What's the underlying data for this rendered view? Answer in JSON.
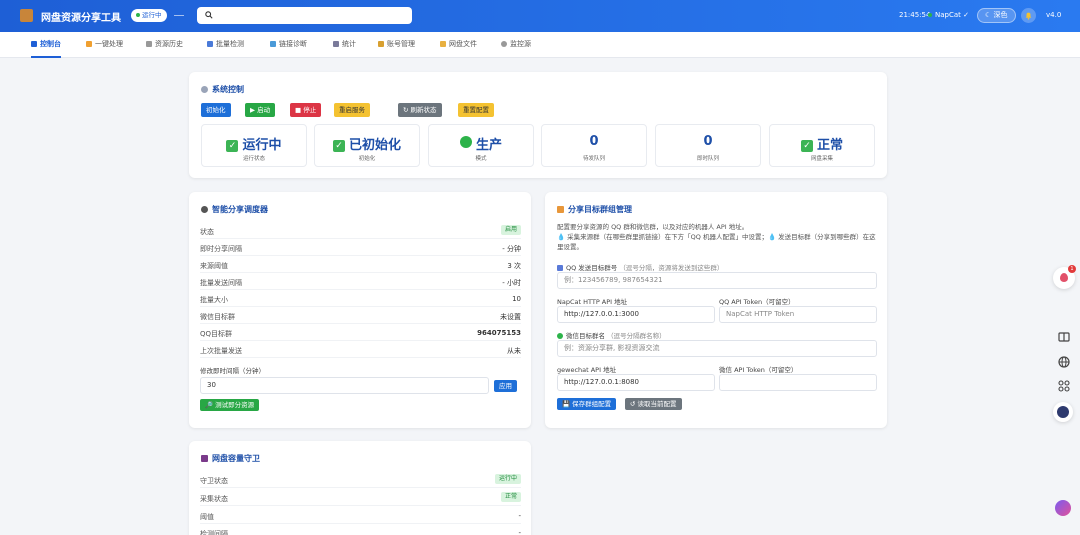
{
  "header": {
    "title": "网盘资源分享工具",
    "status_badge": "运行中",
    "search_placeholder": "",
    "time": "21:45:54",
    "napcat": "NapCat ✓",
    "theme_label": "深色",
    "version": "v4.0"
  },
  "tabs": [
    {
      "label": "控制台",
      "icon": "dashboard-icon",
      "color": "#1e5fd6"
    },
    {
      "label": "一键处理",
      "icon": "bolt-icon",
      "color": "#f0a030"
    },
    {
      "label": "资源历史",
      "icon": "history-icon",
      "color": "#888888"
    },
    {
      "label": "批量检测",
      "icon": "search-icon",
      "color": "#4a7ad8"
    },
    {
      "label": "链接诊断",
      "icon": "link-icon",
      "color": "#4a9ad8"
    },
    {
      "label": "统计",
      "icon": "chart-icon",
      "color": "#7a7a9a"
    },
    {
      "label": "账号管理",
      "icon": "key-icon",
      "color": "#d8a030"
    },
    {
      "label": "网盘文件",
      "icon": "folder-icon",
      "color": "#e8b040"
    },
    {
      "label": "监控源",
      "icon": "eye-icon",
      "color": "#888888"
    }
  ],
  "system_control": {
    "title": "系统控制",
    "buttons": {
      "init": "初始化",
      "start": "▶ 启动",
      "stop": "■ 停止",
      "restart": "重启服务",
      "refresh": "↻ 刷新状态",
      "reset": "重置配置"
    },
    "stats": [
      {
        "value": "运行中",
        "label": "运行状态"
      },
      {
        "value": "已初始化",
        "label": "初始化"
      },
      {
        "value": "生产",
        "label": "模式"
      },
      {
        "value": "0",
        "label": "待发队列"
      },
      {
        "value": "0",
        "label": "即时队列"
      },
      {
        "value": "正常",
        "label": "网盘采集"
      }
    ]
  },
  "smart_share": {
    "title": "智能分享调度器",
    "rows": [
      {
        "key": "状态",
        "value": "启用"
      },
      {
        "key": "即时分享间隔",
        "value": "- 分钟"
      },
      {
        "key": "来源阈值",
        "value": "3 次"
      },
      {
        "key": "批量发送间隔",
        "value": "- 小时"
      },
      {
        "key": "批量大小",
        "value": "10"
      },
      {
        "key": "微信目标群",
        "value": "未设置"
      },
      {
        "key": "QQ目标群",
        "value": "964075153"
      },
      {
        "key": "上次批量发送",
        "value": "从未"
      }
    ],
    "interval_label": "修改即时间隔（分钟）",
    "interval_value": "30",
    "apply_button": "应用",
    "test_button": "测试即分资源"
  },
  "share_target": {
    "title": "分享目标群组管理",
    "desc_line1": "配置要分享资源的 QQ 群和微信群，以及对应的机器人 API 地址。",
    "desc_line2": "💧 采集来源群（在哪些群里抓链接）在下方「QQ 机器人配置」中设置；💧 发送目标群（分享到哪些群）在这里设置。",
    "qq_label": "QQ 发送目标群号",
    "qq_sub": "（逗号分隔，资源将发送到这些群）",
    "qq_placeholder": "例：123456789, 987654321",
    "napcat_api_label": "NapCat HTTP API 地址",
    "napcat_api_value": "http://127.0.0.1:3000",
    "qq_token_label": "QQ API Token（可留空）",
    "qq_token_placeholder": "NapCat HTTP Token",
    "wechat_label": "微信目标群名",
    "wechat_sub": "（逗号分隔群名称）",
    "wechat_placeholder": "例：资源分享群, 影视资源交流",
    "gewechat_label": "gewechat API 地址",
    "gewechat_value": "http://127.0.0.1:8080",
    "wechat_token_label": "微信 API Token（可留空）",
    "save_button": "保存群组配置",
    "read_button": "↺ 读取当前配置"
  },
  "guard": {
    "title": "网盘容量守卫",
    "rows": [
      {
        "key": "守卫状态",
        "value": "运行中"
      },
      {
        "key": "采集状态",
        "value": "正常"
      },
      {
        "key": "阈值",
        "value": "-"
      },
      {
        "key": "检测间隔",
        "value": "-"
      }
    ]
  },
  "side": {
    "badge_count": "1"
  }
}
